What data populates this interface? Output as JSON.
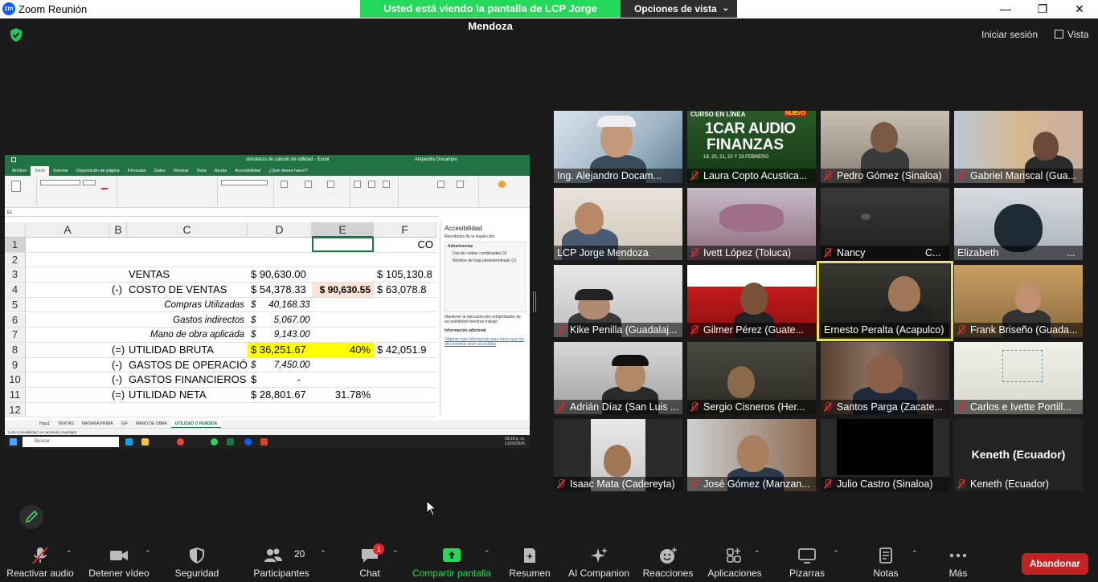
{
  "window": {
    "title": "Zoom Reunión",
    "logo_text": "zm",
    "controls": [
      "—",
      "❐",
      "✕"
    ]
  },
  "share_banner": {
    "text": "Usted está viendo la pantalla de LCP Jorge Mendoza",
    "options_label": "Opciones de vista"
  },
  "top_right": {
    "signin": "Iniciar sesión",
    "view": "Vista"
  },
  "excel": {
    "title": "simulacro de calculo de utilidad - Excel",
    "user": "Alejandro Docampo",
    "ribbon_tabs": [
      "Archivo",
      "Inicio",
      "Insertar",
      "Disposición de página",
      "Fórmulas",
      "Datos",
      "Revisar",
      "Vista",
      "Ayuda",
      "Accesibilidad",
      "¿Qué desea hacer?"
    ],
    "name_box": "E1",
    "columns": [
      "A",
      "B",
      "C",
      "D",
      "E",
      "F"
    ],
    "selected_column": "E",
    "rows": [
      {
        "n": "1",
        "b": "",
        "c": "",
        "d": "",
        "e": "",
        "f": "CO"
      },
      {
        "n": "2",
        "b": "",
        "c": "",
        "d": "",
        "e": "",
        "f": ""
      },
      {
        "n": "3",
        "b": "",
        "c": "VENTAS",
        "d": "$ 90,630.00",
        "e": "",
        "f": "$  105,130.8"
      },
      {
        "n": "4",
        "b": "(-)",
        "c": "COSTO DE VENTAS",
        "d": "$ 54,378.33",
        "e": "$  90,630.55",
        "f": "$    63,078.8"
      },
      {
        "n": "5",
        "b": "",
        "c": "Compras Utilizadas",
        "d": "$     40,168.33",
        "e": "",
        "f": ""
      },
      {
        "n": "6",
        "b": "",
        "c": "Gastos indirectos",
        "d": "$       5,067.00",
        "e": "",
        "f": ""
      },
      {
        "n": "7",
        "b": "",
        "c": "Mano de obra aplicada",
        "d": "$       9,143.00",
        "e": "",
        "f": ""
      },
      {
        "n": "8",
        "b": "(=)",
        "c": "UTILIDAD BRUTA",
        "d": "$ 36,251.67",
        "e": "40%",
        "f": "$    42,051.9"
      },
      {
        "n": "9",
        "b": "(-)",
        "c": "GASTOS DE OPERACIÓN",
        "d": "$       7,450.00",
        "e": "",
        "f": ""
      },
      {
        "n": "10",
        "b": "(-)",
        "c": "GASTOS FINANCIEROS",
        "d": "$              -",
        "e": "",
        "f": ""
      },
      {
        "n": "11",
        "b": "(=)",
        "c": "UTILIDAD NETA",
        "d": "$ 28,801.67",
        "e": "31.78%",
        "f": ""
      },
      {
        "n": "12",
        "b": "",
        "c": "",
        "d": "",
        "e": "",
        "f": ""
      }
    ],
    "sheet_tabs": [
      "Hoja1",
      "VENTAS",
      "MATERIA PRIMA",
      "GIF",
      "MANO DE OBRA",
      "UTILIDAD O PERDIDA"
    ],
    "active_sheet": "UTILIDAD O PERDIDA",
    "status": "Listo    Accesibilidad: es necesario investigar",
    "accessibility": {
      "title": "Accesibilidad",
      "results": "Resultados de la inspección",
      "warnings": "Advertencias",
      "item1": "Uso de celdas combinadas (2)",
      "item2": "Nombre de hoja predeterminado (1)",
      "keep": "Mantener la ejecución del comprobador de accesibilidad mientras trabajo",
      "extra": "Información adicional",
      "link": "Obtener más información para hacer que los documentos sean accesibles"
    },
    "taskbar": {
      "search": "Buscar",
      "time": "09:29 p. m.",
      "date": "21/02/2026"
    }
  },
  "participants": [
    {
      "name": "Ing. Alejandro Docam...",
      "muted": false
    },
    {
      "name": "Laura Copto Acustica...",
      "muted": true
    },
    {
      "name": "Pedro Gómez (Sinaloa)",
      "muted": true
    },
    {
      "name": "Gabriel Mariscal (Gua...",
      "muted": true
    },
    {
      "name": "LCP Jorge Mendoza",
      "muted": false
    },
    {
      "name": "Ivett López (Toluca)",
      "muted": true
    },
    {
      "name": "Nancy",
      "muted": true,
      "suffix": "C..."
    },
    {
      "name": "Elizabeth",
      "muted": false,
      "suffix": "..."
    },
    {
      "name": "Kike Penilla (Guadalaj...",
      "muted": true
    },
    {
      "name": "Gilmer Pérez (Guate...",
      "muted": true
    },
    {
      "name": "Ernesto Peralta (Acapulco)",
      "muted": false,
      "active": true
    },
    {
      "name": "Frank Briseño (Guada...",
      "muted": true
    },
    {
      "name": "Adrián Díaz (San Luis ...",
      "muted": true
    },
    {
      "name": "Sergio Cisneros (Her...",
      "muted": true
    },
    {
      "name": "Santos Parga (Zacate...",
      "muted": true
    },
    {
      "name": "Carlos e Ivette Portill...",
      "muted": true
    },
    {
      "name": "Isaac Mata (Cadereyta)",
      "muted": true
    },
    {
      "name": "José Gómez (Manzan...",
      "muted": true
    },
    {
      "name": "Julio Castro (Sinaloa)",
      "muted": true
    },
    {
      "name": "Keneth (Ecuador)",
      "muted": true,
      "video_off": true
    }
  ],
  "tile2_banner": {
    "line1": "CURSO EN LÍNEA",
    "line2": "1CAR AUDIO",
    "line3": "FINANZAS",
    "badge": "NUEVO",
    "dates": "19, 20, 21, 22 Y 23 FEBRERO"
  },
  "toolbar": {
    "audio": "Reactivar audio",
    "video": "Detener vídeo",
    "security": "Seguridad",
    "participants": "Participantes",
    "participants_count": "20",
    "chat": "Chat",
    "chat_badge": "1",
    "share": "Compartir pantalla",
    "summary": "Resumen",
    "companion": "AI Companion",
    "reactions": "Reacciones",
    "apps": "Aplicaciones",
    "whiteboards": "Pizarras",
    "notes": "Notas",
    "more": "Más",
    "leave": "Abandonar"
  },
  "colors": {
    "share_green": "#23d959",
    "excel_green": "#217346",
    "highlight_yellow": "#ffff00",
    "active_speaker": "#e8e35a",
    "leave_red": "#c42222",
    "mute_red": "#e02828"
  }
}
